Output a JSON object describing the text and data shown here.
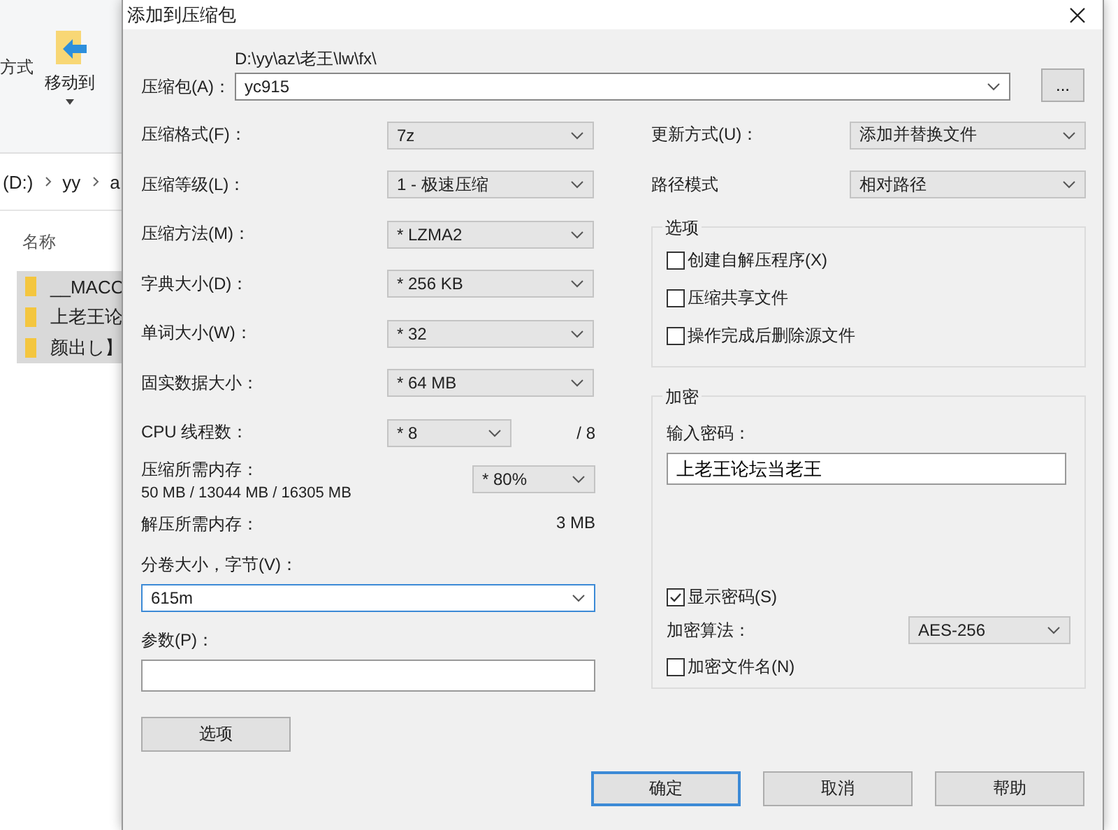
{
  "explorer": {
    "ribbon_text": "方式",
    "move_button": "移动到",
    "breadcrumb": [
      "(D:)",
      "yy",
      "a"
    ],
    "column": "名称",
    "items": [
      {
        "name": "__MACO",
        "selected": true
      },
      {
        "name": "上老王论",
        "selected": true
      },
      {
        "name": "颜出し】",
        "selected": true
      }
    ]
  },
  "window": {
    "title": "添加到压缩包"
  },
  "archive": {
    "label": "压缩包(A)：",
    "path": "D:\\yy\\az\\老王\\lw\\fx\\",
    "value": "yc915",
    "browse": "..."
  },
  "settings": [
    {
      "label": "压缩格式(F)：",
      "value": "7z"
    },
    {
      "label": "压缩等级(L)：",
      "value": "1 - 极速压缩"
    },
    {
      "label": "压缩方法(M)：",
      "value": "* LZMA2"
    },
    {
      "label": "字典大小(D)：",
      "value": "* 256 KB"
    },
    {
      "label": "单词大小(W)：",
      "value": "* 32"
    },
    {
      "label": "固实数据大小：",
      "value": "* 64 MB"
    }
  ],
  "cpu": {
    "label": "CPU 线程数：",
    "value": "* 8",
    "max": "/ 8"
  },
  "memory": {
    "label": "压缩所需内存：",
    "detail": "50 MB / 13044 MB / 16305 MB",
    "value": "* 80%"
  },
  "decompress_memory": {
    "label": "解压所需内存：",
    "value": "3 MB"
  },
  "volume": {
    "label": "分卷大小，字节(V)：",
    "value": "615m",
    "focused": true
  },
  "parameters": {
    "label": "参数(P)："
  },
  "options_button": "选项",
  "update_mode": {
    "label": "更新方式(U)：",
    "value": "添加并替换文件"
  },
  "path_mode": {
    "label": "路径模式",
    "value": "相对路径"
  },
  "options": {
    "title": "选项",
    "checkboxes": [
      {
        "label": "创建自解压程序(X)",
        "checked": false
      },
      {
        "label": "压缩共享文件",
        "checked": false
      },
      {
        "label": "操作完成后删除源文件",
        "checked": false
      }
    ]
  },
  "encryption": {
    "title": "加密",
    "password_label": "输入密码：",
    "password": "上老王论坛当老王",
    "show_password": {
      "label": "显示密码(S)",
      "checked": true
    },
    "method_label": "加密算法：",
    "method": "AES-256",
    "encrypt_names": {
      "label": "加密文件名(N)",
      "checked": false
    }
  },
  "buttons": [
    {
      "label": "确定",
      "selected": true
    },
    {
      "label": "取消",
      "selected": false
    },
    {
      "label": "帮助",
      "selected": false
    }
  ]
}
